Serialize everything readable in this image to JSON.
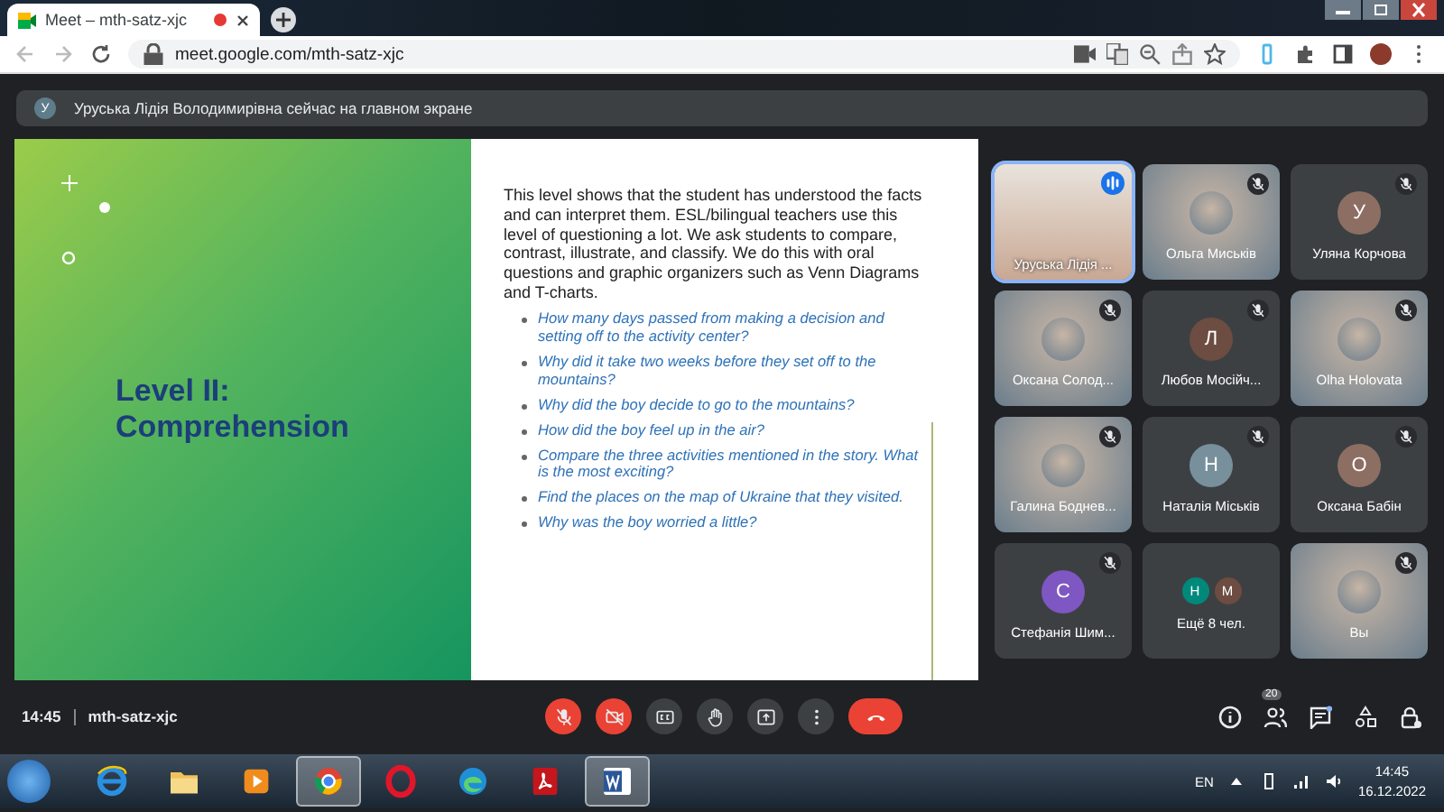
{
  "browser": {
    "tab_title": "Meet – mth-satz-xjc",
    "recording": true,
    "url": "meet.google.com/mth-satz-xjc"
  },
  "banner": {
    "initial": "У",
    "text": "Уруська Лідія Володимирівна сейчас на главном экране"
  },
  "slide": {
    "title": "Level II: Comprehension",
    "intro": "This level shows that the student has understood the facts and can interpret them. ESL/bilingual teachers use this level of questioning a lot. We ask students to compare, contrast, illustrate, and classify. We do this with oral questions and graphic organizers such as Venn Diagrams and T-charts.",
    "questions": [
      "How many days passed from making a decision and setting off to the activity center?",
      "Why did it take two weeks before they set off to the mountains?",
      "Why did the boy decide to go to the mountains?",
      "How did the boy feel up in the air?",
      "Compare the three activities mentioned in the story. What is the most exciting?",
      "Find the places on the map of Ukraine that they visited.",
      "Why was the boy worried a little?"
    ]
  },
  "participants": [
    {
      "kind": "video",
      "name": "Уруська Лідія ...",
      "muted": false,
      "speaking": true
    },
    {
      "kind": "photo",
      "name": "Ольга Миськів",
      "muted": true,
      "speaking": false
    },
    {
      "kind": "initial",
      "name": "Уляна Корчова",
      "initial": "У",
      "color": "#8d6e63",
      "muted": true,
      "speaking": false
    },
    {
      "kind": "photo",
      "name": "Оксана Солод...",
      "muted": true,
      "speaking": false
    },
    {
      "kind": "initial",
      "name": "Любов Мосійч...",
      "initial": "Л",
      "color": "#6d4c41",
      "muted": true,
      "speaking": false
    },
    {
      "kind": "photo",
      "name": "Olha Holovata",
      "muted": true,
      "speaking": false
    },
    {
      "kind": "photo",
      "name": "Галина Боднев...",
      "muted": true,
      "speaking": false
    },
    {
      "kind": "initial",
      "name": "Наталія Міськів",
      "initial": "Н",
      "color": "#78909c",
      "muted": true,
      "speaking": false
    },
    {
      "kind": "initial",
      "name": "Оксана Бабін",
      "initial": "О",
      "color": "#8d6e63",
      "muted": true,
      "speaking": false
    },
    {
      "kind": "initial",
      "name": "Стефанія Шим...",
      "initial": "С",
      "color": "#7e57c2",
      "muted": true,
      "speaking": false
    },
    {
      "kind": "more",
      "name": "Ещё 8 чел.",
      "avatars": [
        {
          "initial": "Н",
          "color": "#00897b"
        },
        {
          "initial": "М",
          "color": "#6d4c41"
        }
      ],
      "muted": false,
      "speaking": false
    },
    {
      "kind": "photo",
      "name": "Вы",
      "muted": true,
      "speaking": false
    }
  ],
  "meeting": {
    "time": "14:45",
    "code": "mth-satz-xjc",
    "people_count": "20"
  },
  "controls": [
    {
      "kind": "mic",
      "off": true
    },
    {
      "kind": "camera",
      "off": true
    },
    {
      "kind": "captions",
      "off": false
    },
    {
      "kind": "hand",
      "off": false
    },
    {
      "kind": "present",
      "off": false
    },
    {
      "kind": "more",
      "off": false
    },
    {
      "kind": "hangup",
      "off": true
    }
  ],
  "taskbar": {
    "apps": [
      {
        "kind": "ie",
        "selected": false
      },
      {
        "kind": "folder",
        "selected": false
      },
      {
        "kind": "media",
        "selected": false
      },
      {
        "kind": "chrome",
        "selected": true
      },
      {
        "kind": "opera",
        "selected": false
      },
      {
        "kind": "edge",
        "selected": false
      },
      {
        "kind": "pdf",
        "selected": false
      },
      {
        "kind": "word",
        "selected": true
      }
    ],
    "language": "EN",
    "time": "14:45",
    "date": "16.12.2022"
  }
}
